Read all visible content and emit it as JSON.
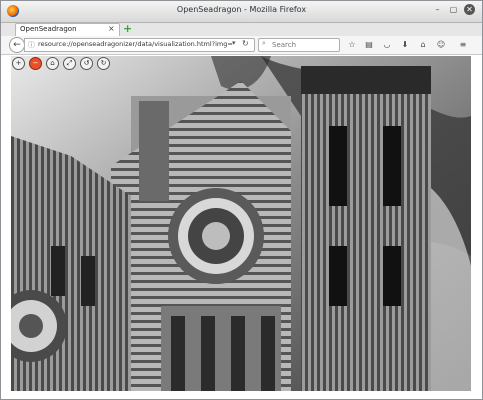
{
  "window": {
    "title": "OpenSeadragon - Mozilla Firefox",
    "minimize_glyph": "–",
    "maximize_glyph": "▢",
    "close_glyph": "✕"
  },
  "tab": {
    "label": "OpenSeadragon",
    "close_glyph": "×",
    "new_tab_glyph": "+"
  },
  "nav": {
    "back_glyph": "←",
    "url": "resource://openseadragonizer/data/visualization.html?img=i...",
    "dropdown_glyph": "▾",
    "reload_glyph": "↻",
    "search_placeholder": "Search",
    "toolbar_icons": [
      "star-icon",
      "reading-list-icon",
      "pocket-icon",
      "download-icon",
      "home-icon",
      "chat-icon",
      "menu-icon"
    ]
  },
  "viewer": {
    "controls": [
      {
        "name": "zoom-in",
        "glyph": "+"
      },
      {
        "name": "zoom-out",
        "glyph": "−",
        "active": true
      },
      {
        "name": "home",
        "glyph": "⌂"
      },
      {
        "name": "fullscreen",
        "glyph": "⤢"
      },
      {
        "name": "rotate-left",
        "glyph": "↺"
      },
      {
        "name": "rotate-right",
        "glyph": "↻"
      }
    ]
  }
}
